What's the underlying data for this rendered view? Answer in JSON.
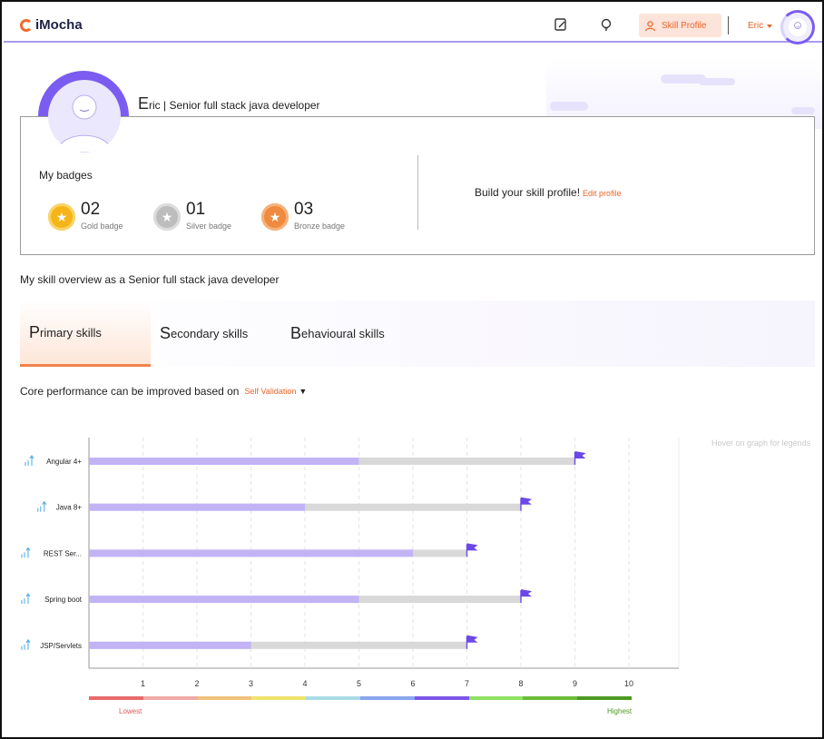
{
  "header": {
    "logo_text": "iMocha",
    "skill_profile_label": "Skill Profile",
    "user_name": "Eric",
    "accent_color": "#e9652a",
    "brand_purple": "#7b5cf0"
  },
  "profile": {
    "name_initial": "E",
    "name_rest": "ric | Senior full stack java developer"
  },
  "badges": {
    "title": "My badges",
    "items": [
      {
        "count": "02",
        "label": "Gold badge",
        "color": "#f5b418",
        "icon": "gold-star-badge-icon"
      },
      {
        "count": "01",
        "label": "Silver badge",
        "color": "#bdbdbd",
        "icon": "silver-star-badge-icon"
      },
      {
        "count": "03",
        "label": "Bronze badge",
        "color": "#f08a3e",
        "icon": "bronze-star-badge-icon"
      }
    ],
    "build_text": "Build your skill profile!",
    "edit_link": "Edit profile"
  },
  "overview_title": "My skill overview as a Senior full stack java developer",
  "tabs": [
    {
      "initial": "P",
      "rest": "rimary skills",
      "active": true
    },
    {
      "initial": "S",
      "rest": "econdary skills",
      "active": false
    },
    {
      "initial": "B",
      "rest": "ehavioural skills",
      "active": false
    }
  ],
  "core": {
    "text": "Core performance can be improved based on",
    "dropdown_value": "Self Validation"
  },
  "hover_hint": "Hover on graph for legends",
  "legend": {
    "low": "Lowest",
    "high": "Highest",
    "colors": [
      "#e86a6a",
      "#efaaa8",
      "#f0c27a",
      "#f1e36a",
      "#a9dbe6",
      "#8aa6ee",
      "#7b55e8",
      "#8fe264",
      "#6cbb3a",
      "#4e9a23"
    ]
  },
  "chart_data": {
    "type": "bar",
    "orientation": "horizontal",
    "categories": [
      "Angular 4+",
      "Java 8+",
      "REST Ser...",
      "Spring boot",
      "JSP/Servlets"
    ],
    "series": [
      {
        "values": [
          5,
          4,
          6,
          5,
          3
        ],
        "color": "#c2b3f5"
      },
      {
        "values": [
          9,
          8,
          7,
          8,
          7
        ],
        "color": "#d9d9d9"
      }
    ],
    "target_flags": [
      9,
      8,
      7,
      8,
      7
    ],
    "x_ticks": [
      1,
      2,
      3,
      4,
      5,
      6,
      7,
      8,
      9,
      10
    ],
    "xlim": [
      0,
      11
    ],
    "grid": true
  }
}
